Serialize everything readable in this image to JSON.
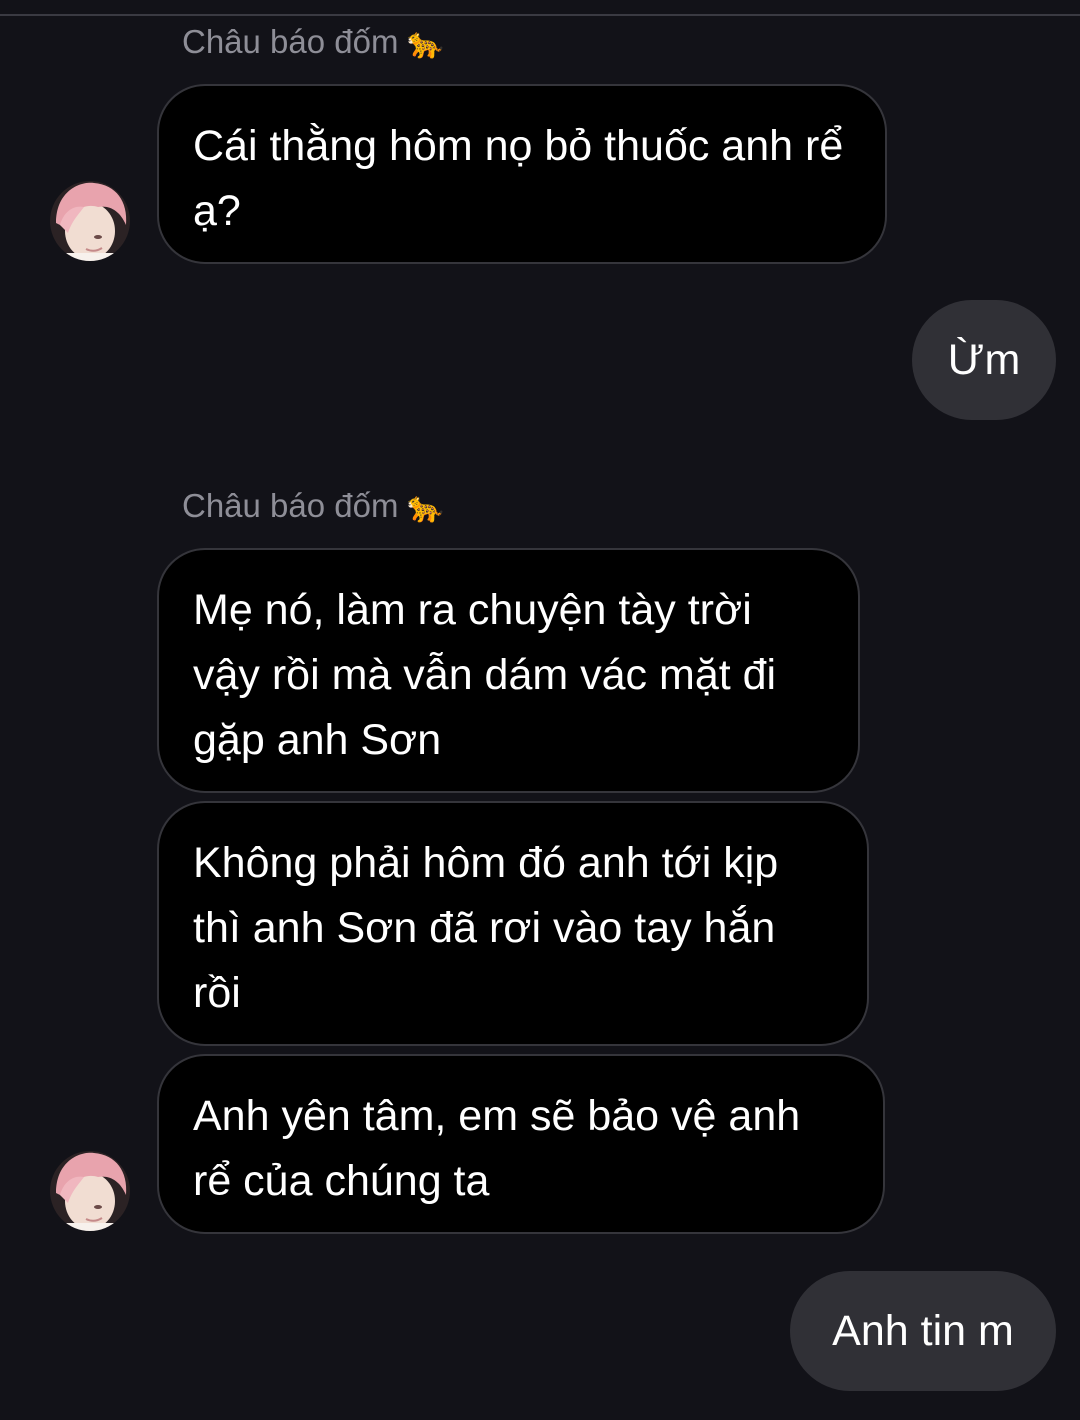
{
  "conversation": {
    "contact_name": "Châu báo đốm",
    "contact_emoji": "🐆",
    "messages": [
      {
        "side": "in",
        "text": "Cái thằng hôm nọ bỏ thuốc anh rể ạ?"
      },
      {
        "side": "out",
        "text": "Ừm"
      },
      {
        "side": "in",
        "text": "Mẹ nó, làm ra chuyện tày trời vậy rồi mà vẫn dám vác mặt đi gặp anh Sơn"
      },
      {
        "side": "in",
        "text": "Không phải hôm đó anh tới kịp thì anh Sơn đã rơi vào tay hắn rồi"
      },
      {
        "side": "in",
        "text": "Anh yên tâm, em sẽ bảo vệ anh rể của chúng ta"
      },
      {
        "side": "out",
        "text": "Anh tin m"
      }
    ]
  },
  "colors": {
    "background": "#121218",
    "incoming_bubble": "#000000",
    "outgoing_bubble": "#303036",
    "sender_name": "#8e8e97"
  }
}
